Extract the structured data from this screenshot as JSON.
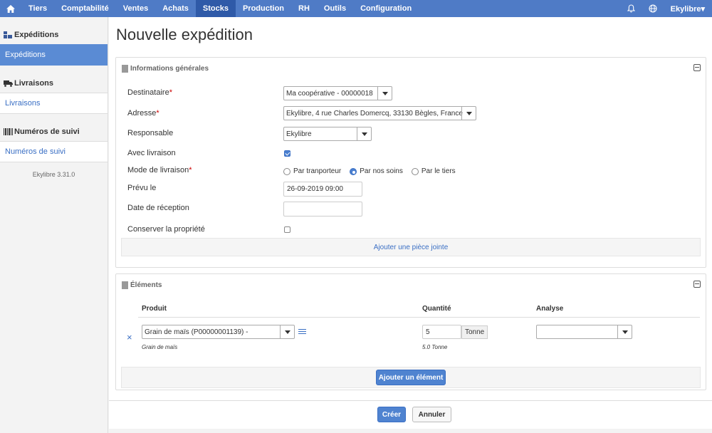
{
  "nav": {
    "items": [
      "Tiers",
      "Comptabilité",
      "Ventes",
      "Achats",
      "Stocks",
      "Production",
      "RH",
      "Outils",
      "Configuration"
    ],
    "active": "Stocks",
    "user": "Ekylibre▾"
  },
  "sidebar": {
    "sections": [
      {
        "title": "Expéditions",
        "link": "Expéditions"
      },
      {
        "title": "Livraisons",
        "link": "Livraisons"
      },
      {
        "title": "Numéros de suivi",
        "link": "Numéros de suivi"
      }
    ],
    "version": "Ekylibre 3.31.0"
  },
  "page": {
    "title": "Nouvelle expédition"
  },
  "general": {
    "title": "Informations générales",
    "destinataire_label": "Destinataire",
    "destinataire_value": "Ma coopérative - 00000018",
    "adresse_label": "Adresse",
    "adresse_value": "Ekylibre, 4 rue Charles Domercq, 33130 Bègles, France",
    "responsable_label": "Responsable",
    "responsable_value": "Ekylibre",
    "avec_livraison_label": "Avec livraison",
    "avec_livraison_checked": true,
    "mode_label": "Mode de livraison",
    "mode_options": [
      "Par tranporteur",
      "Par nos soins",
      "Par le tiers"
    ],
    "mode_selected": "Par nos soins",
    "prevu_label": "Prévu le",
    "prevu_value": "26-09-2019 09:00",
    "reception_label": "Date de réception",
    "reception_value": "",
    "conserver_label": "Conserver la propriété",
    "conserver_checked": false,
    "attach_label": "Ajouter une pièce jointe"
  },
  "elements": {
    "title": "Éléments",
    "headers": {
      "produit": "Produit",
      "quantite": "Quantité",
      "analyse": "Analyse"
    },
    "row": {
      "remove": "×",
      "produit_value": "Grain de maïs (P00000001139) -",
      "produit_sub": "Grain de maïs",
      "quantite_value": "5",
      "unit": "Tonne",
      "quantite_sub": "5.0 Tonne",
      "analyse_value": ""
    },
    "add_label": "Ajouter un élément"
  },
  "actions": {
    "create": "Créer",
    "cancel": "Annuler"
  },
  "colors": {
    "nav": "#4f7bc6",
    "nav_active": "#2f5aa8",
    "accent": "#3a6fc4"
  }
}
